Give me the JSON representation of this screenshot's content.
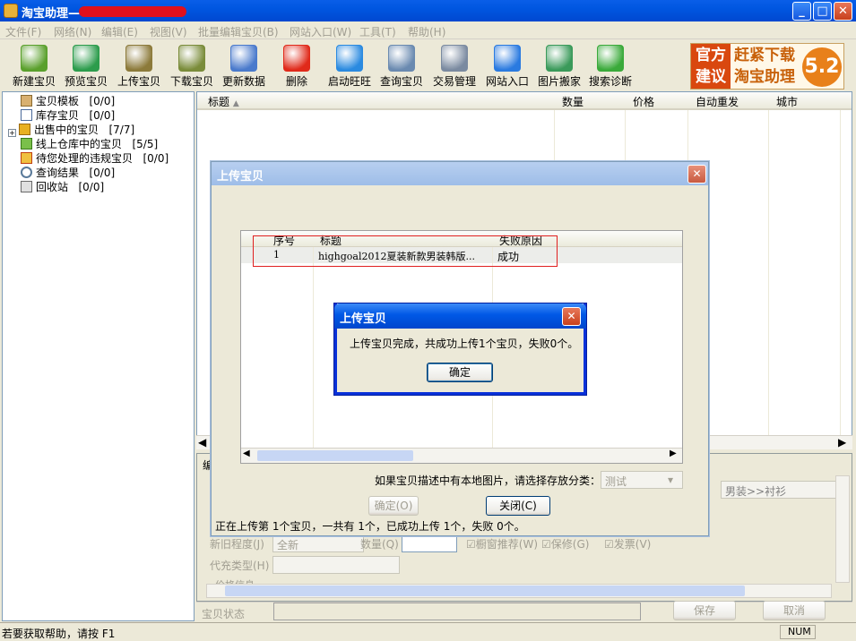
{
  "window": {
    "title": "淘宝助理—",
    "min_glyph": "_",
    "max_glyph": "□",
    "close_glyph": "✕"
  },
  "menu": [
    "文件(F)",
    "网络(N)",
    "编辑(E)",
    "视图(V)",
    "批量编辑宝贝(B)",
    "网站入口(W)",
    "工具(T)",
    "帮助(H)"
  ],
  "toolbar": [
    {
      "label": "新建宝贝",
      "icon": "new-item-icon",
      "color": "#5aa02c"
    },
    {
      "label": "预览宝贝",
      "icon": "preview-icon",
      "color": "#2c9c4c"
    },
    {
      "label": "上传宝贝",
      "icon": "upload-icon",
      "color": "#8c7a3a"
    },
    {
      "label": "下载宝贝",
      "icon": "download-icon",
      "color": "#7a8c3a"
    },
    {
      "label": "更新数据",
      "icon": "update-data-icon",
      "color": "#4a7acc"
    },
    {
      "label": "删除",
      "icon": "delete-icon",
      "color": "#e02a1a"
    },
    {
      "label": "启动旺旺",
      "icon": "wangwang-icon",
      "color": "#2a8ae0"
    },
    {
      "label": "查询宝贝",
      "icon": "search-icon",
      "color": "#6a8ab0"
    },
    {
      "label": "交易管理",
      "icon": "gear-icon",
      "color": "#7a8aa0"
    },
    {
      "label": "网站入口",
      "icon": "ie-icon",
      "color": "#2a7ae0"
    },
    {
      "label": "图片搬家",
      "icon": "picture-move-icon",
      "color": "#3a9a5a"
    },
    {
      "label": "搜索诊断",
      "icon": "search-diagnose-icon",
      "color": "#3aaa3a"
    }
  ],
  "ad": {
    "left": "官方建议",
    "mid1": "赶紧下载",
    "mid2": "淘宝助理",
    "version": "5.2"
  },
  "tree": [
    {
      "label": "宝贝模板",
      "count": "[0/0]",
      "icon": "template-icon"
    },
    {
      "label": "库存宝贝",
      "count": "[0/0]",
      "icon": "warehouse-icon"
    },
    {
      "label": "出售中的宝贝",
      "count": "[7/7]",
      "icon": "on-sale-icon"
    },
    {
      "label": "线上仓库中的宝贝",
      "count": "[5/5]",
      "icon": "online-warehouse-icon"
    },
    {
      "label": "待您处理的违规宝贝",
      "count": "[0/0]",
      "icon": "violation-icon"
    },
    {
      "label": "查询结果",
      "count": "[0/0]",
      "icon": "search-result-icon"
    },
    {
      "label": "回收站",
      "count": "[0/0]",
      "icon": "recycle-bin-icon"
    }
  ],
  "grid": {
    "headers": [
      "标题",
      "数量",
      "价格",
      "自动重发",
      "城市"
    ]
  },
  "lower": {
    "tab_stub": "编",
    "category": "男装>>衬衫",
    "condition_label": "新旧程度(J)",
    "condition_value": "全新",
    "quantity_label": "数量(Q)",
    "showcase": "橱窗推荐(W)",
    "warranty": "保修(G)",
    "invoice": "发票(V)",
    "recharge_label": "代充类型(H)",
    "price_stub": "价格信息"
  },
  "item_status": {
    "label": "宝贝状态",
    "save": "保存",
    "cancel": "取消"
  },
  "statusbar": {
    "help": "若要获取帮助，请按 F1",
    "num": "NUM"
  },
  "upload_dialog": {
    "title": "上传宝贝",
    "columns": [
      "序号",
      "标题",
      "失败原因"
    ],
    "rows": [
      {
        "no": "1",
        "title": "highgoal2012夏装新款男装韩版...",
        "reason": "成功"
      }
    ],
    "local_img_label": "如果宝贝描述中有本地图片，请选择存放分类：",
    "category_value": "测试",
    "ok": "确定(O)",
    "close": "关闭(C)",
    "progress": "正在上传第 1个宝贝，一共有 1个，已成功上传 1个，失败 0个。"
  },
  "confirm_dialog": {
    "title": "上传宝贝",
    "message": "上传宝贝完成，共成功上传1个宝贝，失败0个。",
    "ok": "确定"
  }
}
